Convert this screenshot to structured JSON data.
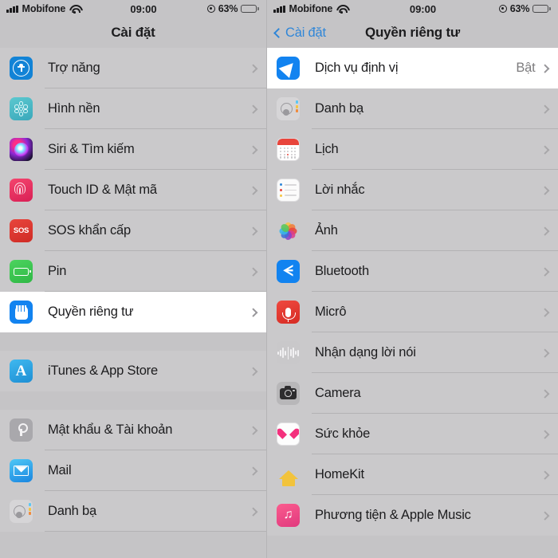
{
  "status_bar": {
    "carrier": "Mobifone",
    "time": "09:00",
    "battery_percent": "63%",
    "wifi_icon": "wifi-icon",
    "signal_icon": "cellular-bars-icon",
    "location_icon": "location-services-indicator-icon",
    "battery_icon": "battery-icon"
  },
  "left_screen": {
    "nav": {
      "title": "Cài đặt"
    },
    "sections": [
      {
        "rows": [
          {
            "label": "Trợ năng",
            "icon": "accessibility-icon",
            "selected": false
          },
          {
            "label": "Hình nền",
            "icon": "wallpaper-icon",
            "selected": false
          },
          {
            "label": "Siri & Tìm kiếm",
            "icon": "siri-icon",
            "selected": false
          },
          {
            "label": "Touch ID & Mật mã",
            "icon": "touch-id-icon",
            "selected": false
          },
          {
            "label": "SOS khẩn cấp",
            "icon": "sos-icon",
            "selected": false
          },
          {
            "label": "Pin",
            "icon": "battery-settings-icon",
            "selected": false
          },
          {
            "label": "Quyền riêng tư",
            "icon": "privacy-hand-icon",
            "selected": true
          }
        ]
      },
      {
        "rows": [
          {
            "label": "iTunes & App Store",
            "icon": "app-store-icon",
            "selected": false
          }
        ]
      },
      {
        "rows": [
          {
            "label": "Mật khẩu & Tài khoản",
            "icon": "passwords-key-icon",
            "selected": false
          },
          {
            "label": "Mail",
            "icon": "mail-icon",
            "selected": false
          },
          {
            "label": "Danh bạ",
            "icon": "contacts-icon",
            "selected": false
          }
        ]
      }
    ]
  },
  "right_screen": {
    "nav": {
      "back_label": "Cài đặt",
      "title": "Quyền riêng tư",
      "back_icon": "chevron-left-icon"
    },
    "rows": [
      {
        "label": "Dịch vụ định vị",
        "value": "Bật",
        "icon": "location-services-icon",
        "selected": true
      },
      {
        "label": "Danh bạ",
        "value": "",
        "icon": "contacts-icon",
        "selected": false
      },
      {
        "label": "Lịch",
        "value": "",
        "icon": "calendar-icon",
        "selected": false
      },
      {
        "label": "Lời nhắc",
        "value": "",
        "icon": "reminders-icon",
        "selected": false
      },
      {
        "label": "Ảnh",
        "value": "",
        "icon": "photos-icon",
        "selected": false
      },
      {
        "label": "Bluetooth",
        "value": "",
        "icon": "bluetooth-icon",
        "selected": false
      },
      {
        "label": "Micrô",
        "value": "",
        "icon": "microphone-icon",
        "selected": false
      },
      {
        "label": "Nhận dạng lời nói",
        "value": "",
        "icon": "speech-recognition-icon",
        "selected": false
      },
      {
        "label": "Camera",
        "value": "",
        "icon": "camera-icon",
        "selected": false
      },
      {
        "label": "Sức khỏe",
        "value": "",
        "icon": "health-icon",
        "selected": false
      },
      {
        "label": "HomeKit",
        "value": "",
        "icon": "homekit-icon",
        "selected": false
      },
      {
        "label": "Phương tiện & Apple Music",
        "value": "",
        "icon": "apple-music-icon",
        "selected": false
      }
    ]
  },
  "colors": {
    "accent": "#2f86d8",
    "background": "#c5c4c6",
    "selected_row": "#ffffff",
    "text": "#1c1c1e",
    "secondary_text": "#7d7c7e"
  }
}
